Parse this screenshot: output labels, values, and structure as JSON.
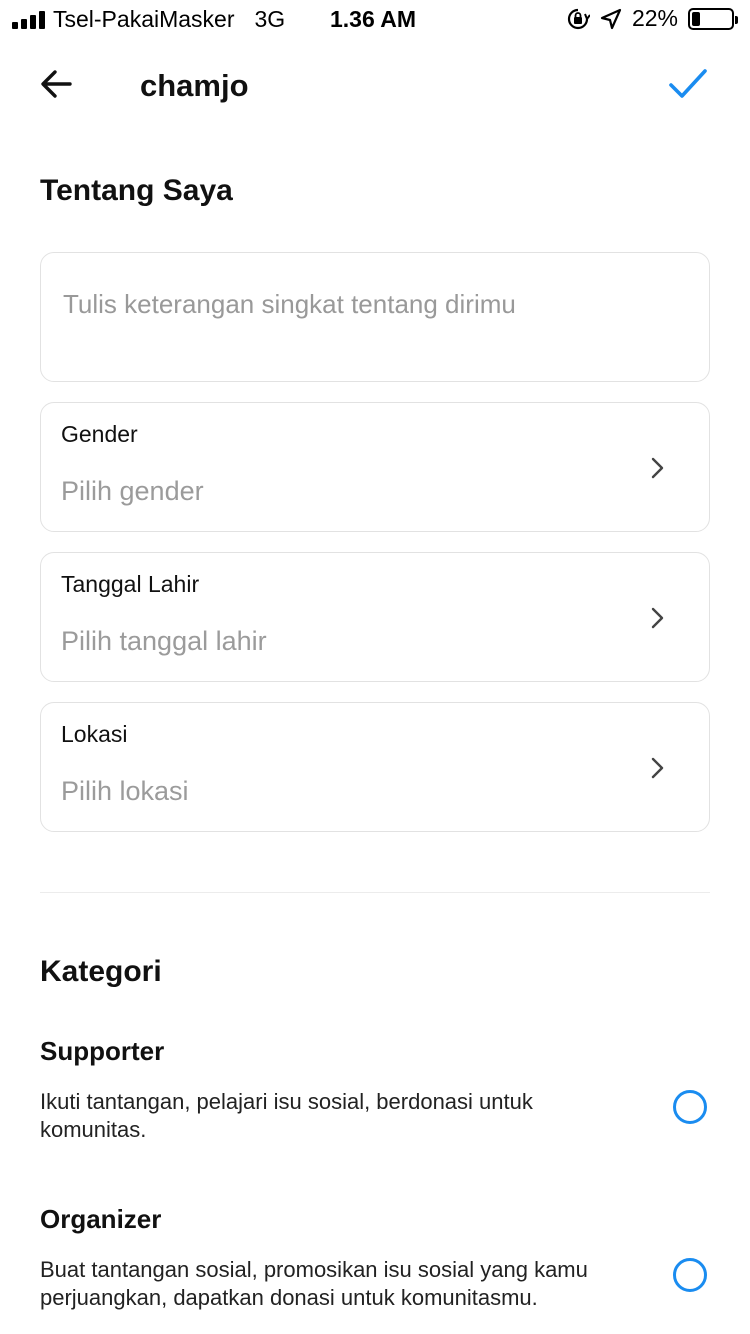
{
  "status_bar": {
    "carrier": "Tsel-PakaiMasker",
    "network": "3G",
    "time": "1.36 AM",
    "battery_percent": "22%",
    "battery_level": 0.22,
    "icons": [
      "signal-icon",
      "orientation-lock-icon",
      "location-arrow-icon",
      "battery-icon"
    ]
  },
  "header": {
    "title": "chamjo",
    "back_icon": "arrow-left-icon",
    "save_icon": "checkmark-icon"
  },
  "about": {
    "title": "Tentang Saya",
    "bio_placeholder": "Tulis keterangan singkat tentang dirimu",
    "bio_value": ""
  },
  "fields": [
    {
      "label": "Gender",
      "placeholder": "Pilih gender"
    },
    {
      "label": "Tanggal Lahir",
      "placeholder": "Pilih tanggal lahir"
    },
    {
      "label": "Lokasi",
      "placeholder": "Pilih lokasi"
    }
  ],
  "categories": {
    "title": "Kategori",
    "items": [
      {
        "name": "Supporter",
        "description": "Ikuti tantangan, pelajari isu sosial, berdonasi untuk komunitas.",
        "selected": false
      },
      {
        "name": "Organizer",
        "description": "Buat tantangan sosial, promosikan isu sosial yang kamu perjuangkan, dapatkan donasi untuk komunitasmu.",
        "selected": false
      }
    ]
  },
  "colors": {
    "accent": "#1a8cf0",
    "border": "#e2e2e2",
    "placeholder_text": "#9b9b9b"
  }
}
